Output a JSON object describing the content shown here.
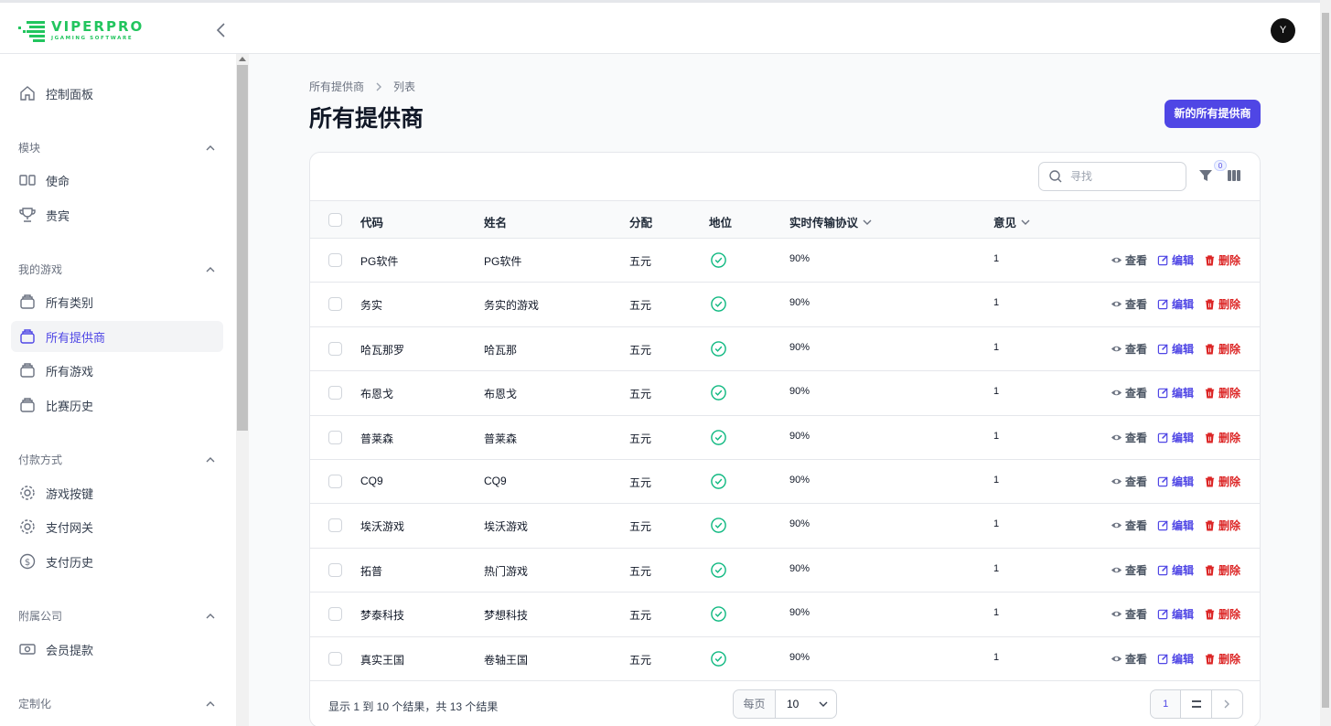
{
  "brand": {
    "title": "VIPERPRO",
    "subtitle": "JGAMING SOFTWARE",
    "color": "#22c55e"
  },
  "user": {
    "avatar_initial": "Y"
  },
  "sidebar": {
    "dashboard": "控制面板",
    "groups": [
      {
        "label": "模块",
        "items": [
          "使命",
          "贵宾"
        ]
      },
      {
        "label": "我的游戏",
        "items": [
          "所有类别",
          "所有提供商",
          "所有游戏",
          "比赛历史"
        ]
      },
      {
        "label": "付款方式",
        "items": [
          "游戏按键",
          "支付网关",
          "支付历史"
        ]
      },
      {
        "label": "附属公司",
        "items": [
          "会员提款"
        ]
      },
      {
        "label": "定制化",
        "items": []
      }
    ],
    "active_item": "所有提供商"
  },
  "breadcrumb": {
    "parent": "所有提供商",
    "current": "列表"
  },
  "page": {
    "title": "所有提供商",
    "new_button": "新的所有提供商"
  },
  "toolbar": {
    "search_placeholder": "寻找",
    "filter_count": "0"
  },
  "table": {
    "columns": [
      "代码",
      "姓名",
      "分配",
      "地位",
      "实时传输协议",
      "意见"
    ],
    "rows": [
      {
        "code": "PG软件",
        "name": "PG软件",
        "distribution": "五元",
        "rtp": "90%",
        "views": "1"
      },
      {
        "code": "务实",
        "name": "务实的游戏",
        "distribution": "五元",
        "rtp": "90%",
        "views": "1"
      },
      {
        "code": "哈瓦那罗",
        "name": "哈瓦那",
        "distribution": "五元",
        "rtp": "90%",
        "views": "1"
      },
      {
        "code": "布恩戈",
        "name": "布恩戈",
        "distribution": "五元",
        "rtp": "90%",
        "views": "1"
      },
      {
        "code": "普莱森",
        "name": "普莱森",
        "distribution": "五元",
        "rtp": "90%",
        "views": "1"
      },
      {
        "code": "CQ9",
        "name": "CQ9",
        "distribution": "五元",
        "rtp": "90%",
        "views": "1"
      },
      {
        "code": "埃沃游戏",
        "name": "埃沃游戏",
        "distribution": "五元",
        "rtp": "90%",
        "views": "1"
      },
      {
        "code": "拓普",
        "name": "热门游戏",
        "distribution": "五元",
        "rtp": "90%",
        "views": "1"
      },
      {
        "code": "梦泰科技",
        "name": "梦想科技",
        "distribution": "五元",
        "rtp": "90%",
        "views": "1"
      },
      {
        "code": "真实王国",
        "name": "卷轴王国",
        "distribution": "五元",
        "rtp": "90%",
        "views": "1"
      }
    ],
    "actions": {
      "view": "查看",
      "edit": "编辑",
      "delete": "删除"
    }
  },
  "footer": {
    "summary": "显示 1 到 10 个结果，共 13 个结果",
    "per_page_label": "每页",
    "per_page_value": "10",
    "current_page": "1"
  },
  "colors": {
    "accent": "#4f46e5",
    "success": "#10b981",
    "danger": "#dc2626"
  }
}
